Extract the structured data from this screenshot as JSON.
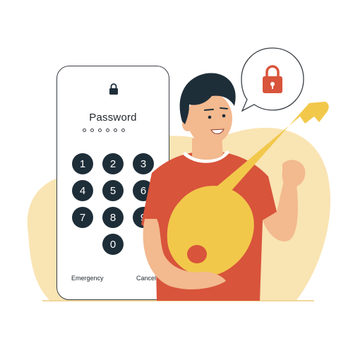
{
  "phone": {
    "title": "Password",
    "pin_length": 6,
    "keys": [
      "1",
      "2",
      "3",
      "4",
      "5",
      "6",
      "7",
      "8",
      "9",
      "0"
    ],
    "emergency_label": "Emergency",
    "cancel_label": "Cancel"
  },
  "icons": {
    "phone_lock": "lock-icon",
    "bubble_lock": "padlock-icon"
  },
  "colors": {
    "keypad": "#1e2e39",
    "shirt": "#d8543b",
    "key": "#f2c84b",
    "blob": "#f9e4b3",
    "skin": "#f3b98f",
    "lock_badge": "#d8543b"
  }
}
